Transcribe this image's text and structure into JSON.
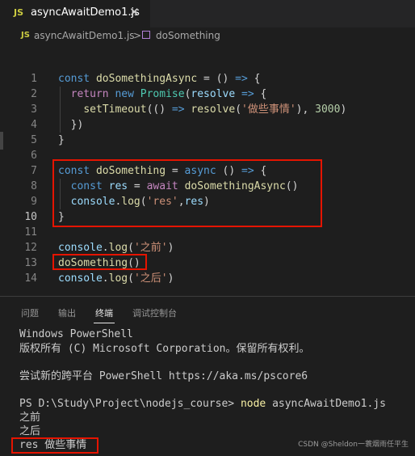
{
  "tab": {
    "icon": "JS",
    "filename": "asyncAwaitDemo1.js",
    "close": "✕"
  },
  "breadcrumb": {
    "icon": "JS",
    "file": "asyncAwaitDemo1.js",
    "separator": ">",
    "symbol": "doSomething",
    "symbol_icon": "cube-icon"
  },
  "code": {
    "line_numbers": [
      "1",
      "2",
      "3",
      "4",
      "5",
      "6",
      "7",
      "8",
      "9",
      "10",
      "11",
      "12",
      "13",
      "14"
    ],
    "l1": {
      "kw": "const",
      "name": "doSomethingAsync",
      "rest": " = () ",
      "arrow": "=>",
      "brace": " {"
    },
    "l2": {
      "kw": "return",
      "new": "new",
      "cls": "Promise",
      "p1": "(",
      "param": "resolve",
      "arrow": " => ",
      "brace": "{"
    },
    "l3": {
      "fn": "setTimeout",
      "p1": "(() ",
      "arrow": "=>",
      "sp": " ",
      "fn2": "resolve",
      "p2": "(",
      "str": "'做些事情'",
      "p3": "), ",
      "num": "3000",
      "p4": ")"
    },
    "l4": {
      "text": "})"
    },
    "l5": {
      "text": "}"
    },
    "l7": {
      "kw": "const",
      "name": "doSomething",
      "eq": " = ",
      "async": "async",
      "rest": " () ",
      "arrow": "=>",
      "brace": " {"
    },
    "l8": {
      "kw": "const",
      "var": "res",
      "eq": " = ",
      "await": "await",
      "fn": "doSomethingAsync",
      "rest": "()"
    },
    "l9": {
      "obj": "console",
      "dot": ".",
      "fn": "log",
      "p1": "(",
      "str": "'res'",
      "comma": ",",
      "var": "res",
      "p2": ")"
    },
    "l10": {
      "text": "}"
    },
    "l12": {
      "obj": "console",
      "dot": ".",
      "fn": "log",
      "p1": "(",
      "str": "'之前'",
      "p2": ")"
    },
    "l13": {
      "fn": "doSomething",
      "p": "()"
    },
    "l14": {
      "obj": "console",
      "dot": ".",
      "fn": "log",
      "p1": "(",
      "str": "'之后'",
      "p2": ")"
    }
  },
  "panel": {
    "tabs": [
      "问题",
      "输出",
      "终端",
      "调试控制台"
    ],
    "active_tab": "终端"
  },
  "terminal": {
    "line1": "Windows PowerShell",
    "line2": "版权所有 (C) Microsoft Corporation。保留所有权利。",
    "line3": "尝试新的跨平台 PowerShell https://aka.ms/pscore6",
    "prompt": "PS D:\\Study\\Project\\nodejs_course> ",
    "cmd": "node",
    "arg": " asyncAwaitDemo1.js",
    "out1": "之前",
    "out2": "之后",
    "out3": "res 做些事情"
  },
  "watermark": "CSDN @Sheldon一蓑烟雨任平生",
  "colors": {
    "highlight_box": "#e51400",
    "background": "#1e1e1e"
  }
}
